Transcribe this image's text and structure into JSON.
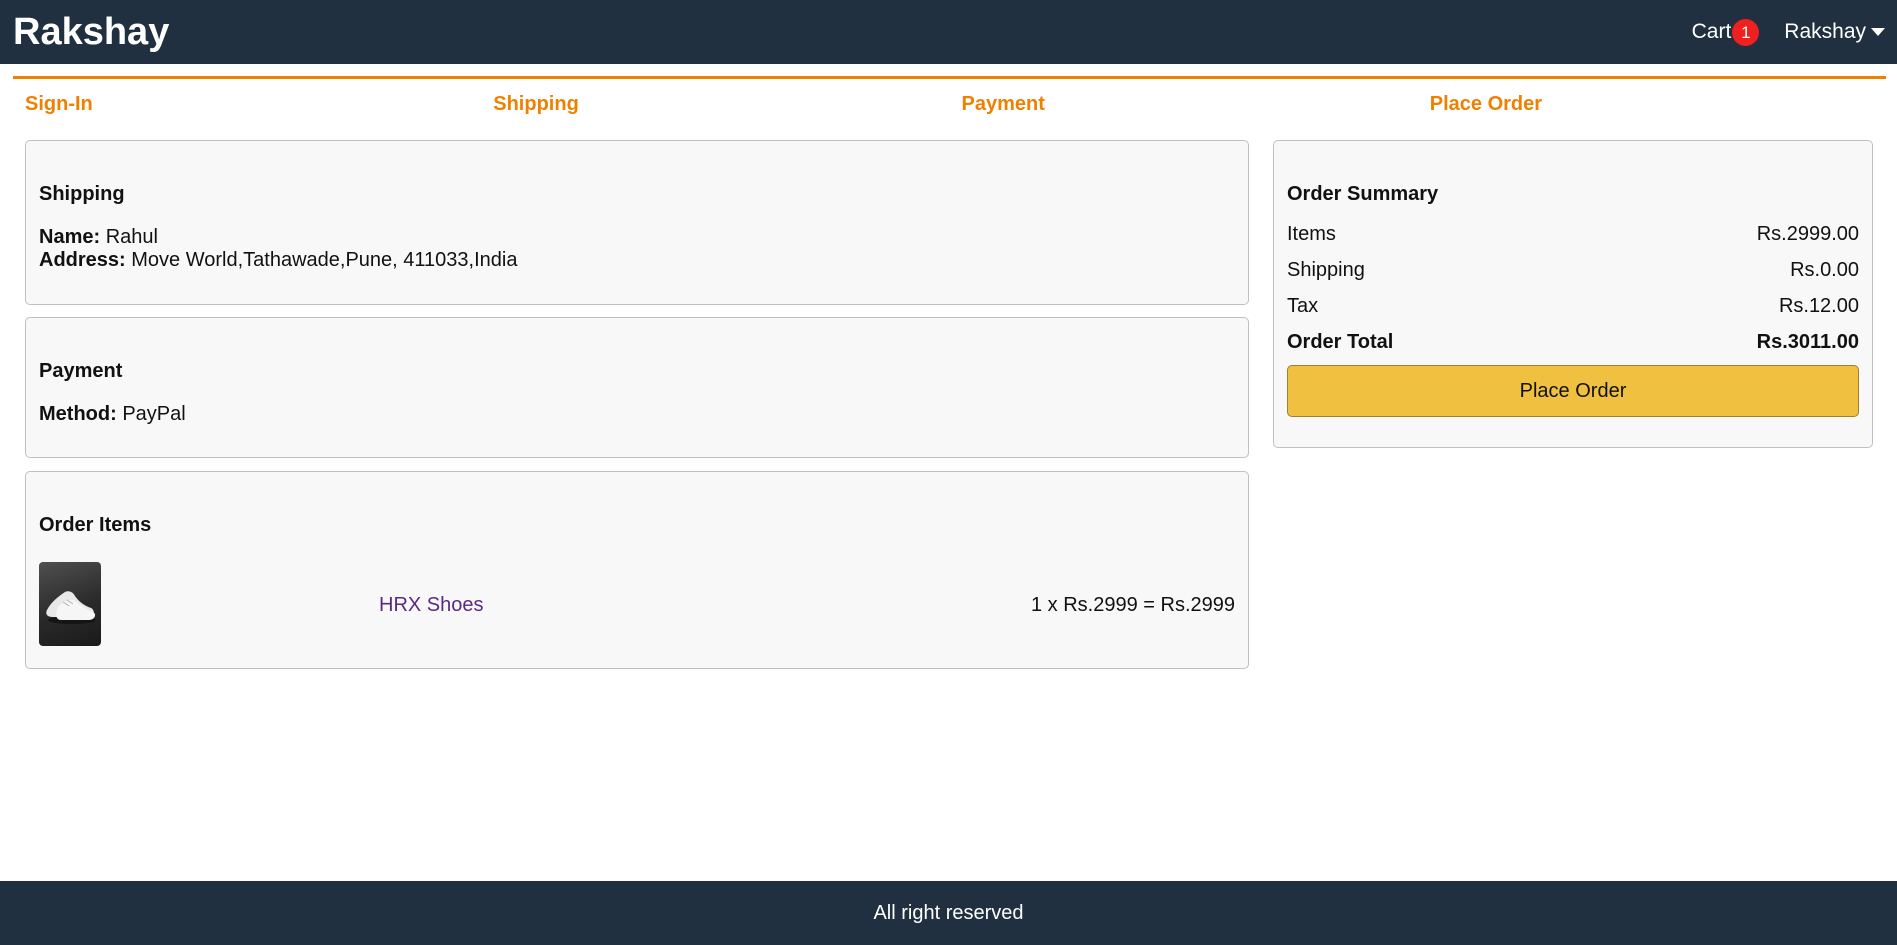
{
  "header": {
    "brand": "Rakshay",
    "cart_label": "Cart",
    "cart_count": "1",
    "user_name": "Rakshay"
  },
  "steps": [
    "Sign-In",
    "Shipping",
    "Payment",
    "Place Order"
  ],
  "shipping": {
    "title": "Shipping",
    "name_label": "Name:",
    "name_value": "Rahul",
    "address_label": "Address:",
    "address_value": "Move World,Tathawade,Pune, 411033,India"
  },
  "payment": {
    "title": "Payment",
    "method_label": "Method:",
    "method_value": "PayPal"
  },
  "order_items": {
    "title": "Order Items",
    "items": [
      {
        "name": "HRX Shoes",
        "price_line": "1 x Rs.2999 = Rs.2999"
      }
    ]
  },
  "summary": {
    "title": "Order Summary",
    "items_label": "Items",
    "items_value": "Rs.2999.00",
    "shipping_label": "Shipping",
    "shipping_value": "Rs.0.00",
    "tax_label": "Tax",
    "tax_value": "Rs.12.00",
    "total_label": "Order Total",
    "total_value": "Rs.3011.00",
    "button_label": "Place Order"
  },
  "footer": {
    "text": "All right reserved"
  },
  "colors": {
    "header_bg": "#203040",
    "accent_orange": "#f08000",
    "button_yellow": "#f0c040",
    "badge_red": "#f02020",
    "link_purple": "#5a2a80"
  }
}
